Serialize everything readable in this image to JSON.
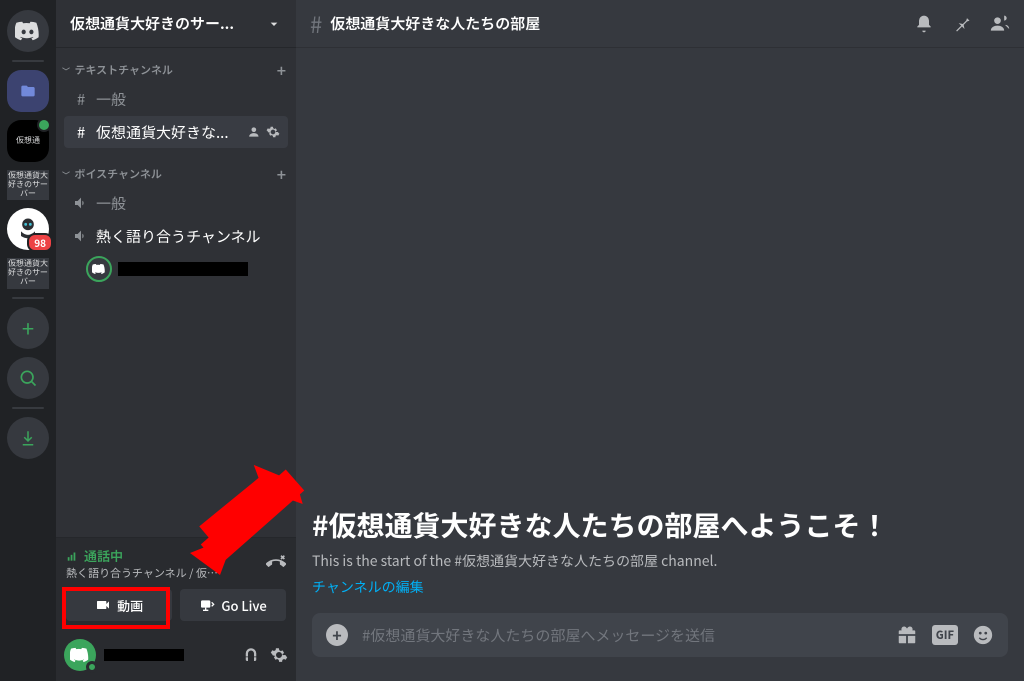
{
  "server": {
    "name": "仮想通貨大好きのサー...",
    "label1": "仮想通貨大好きのサーバー",
    "label2": "仮想通貨大好きのサーバー",
    "badge": "98"
  },
  "categories": {
    "text": "テキストチャンネル",
    "voice": "ボイスチャンネル"
  },
  "channels": {
    "general": "一般",
    "active": "仮想通貨大好きな...",
    "voiceGeneral": "一般",
    "voiceHot": "熱く語り合うチャンネル"
  },
  "voicePanel": {
    "status": "通話中",
    "sub": "熱く語り合うチャンネル / 仮想...",
    "videoBtn": "動画",
    "goLiveBtn": "Go Live"
  },
  "mainHeader": {
    "title": "仮想通貨大好きな人たちの部屋"
  },
  "welcome": {
    "title": "#仮想通貨大好きな人たちの部屋へようこそ！",
    "sub": "This is the start of the #仮想通貨大好きな人たちの部屋 channel.",
    "link": "チャンネルの編集"
  },
  "input": {
    "placeholder": "#仮想通貨大好きな人たちの部屋へメッセージを送信",
    "gif": "GIF"
  }
}
